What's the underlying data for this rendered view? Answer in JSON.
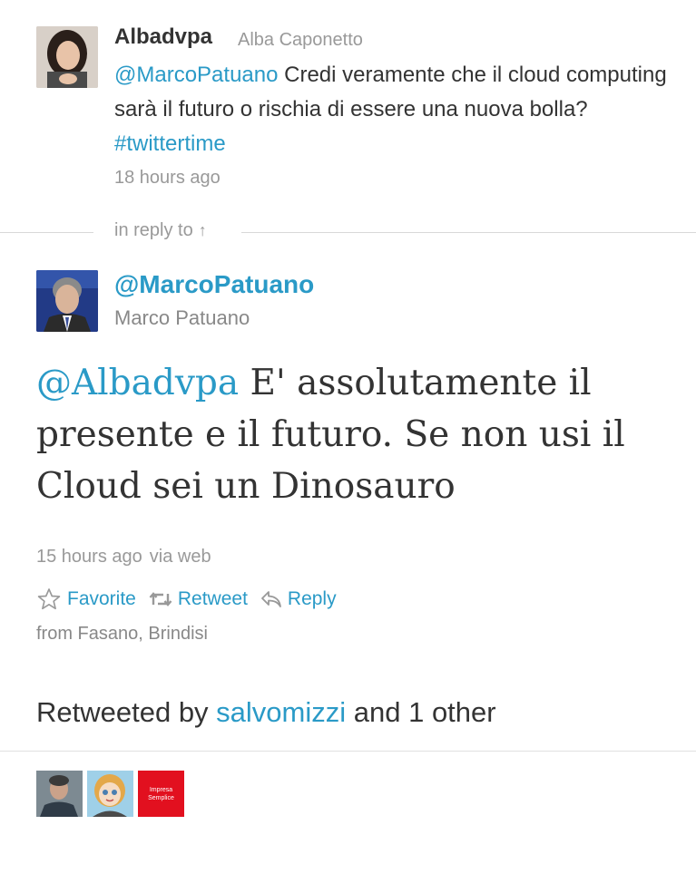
{
  "reply_tweet": {
    "screen_name": "Albadvpa",
    "full_name": "Alba Caponetto",
    "mention": "@MarcoPatuano",
    "text": " Credi veramente che il cloud computing sarà il futuro o rischia di essere una nuova bolla? ",
    "hashtag": "#twittertime",
    "time": "18 hours ago"
  },
  "in_reply_to": {
    "label": "in reply to",
    "arrow": "↑"
  },
  "main_tweet": {
    "screen_name": "@MarcoPatuano",
    "full_name": "Marco Patuano",
    "mention": "@Albadvpa",
    "text": " E' assolutamente il presente e il futuro. Se non usi il Cloud sei un Dinosauro",
    "time": "15 hours ago",
    "via": "via web",
    "location": "from Fasano, Brindisi"
  },
  "actions": {
    "favorite": "Favorite",
    "retweet": "Retweet",
    "reply": "Reply"
  },
  "retweeted_by": {
    "prefix": "Retweeted by ",
    "user": "salvomizzi",
    "suffix": " and 1 other"
  },
  "retweeter_avatars": {
    "third_avatar_text_line1": "Impresa",
    "third_avatar_text_line2": "Semplice"
  },
  "colors": {
    "link": "#2a9ac7",
    "text": "#333333",
    "muted": "#999999"
  }
}
